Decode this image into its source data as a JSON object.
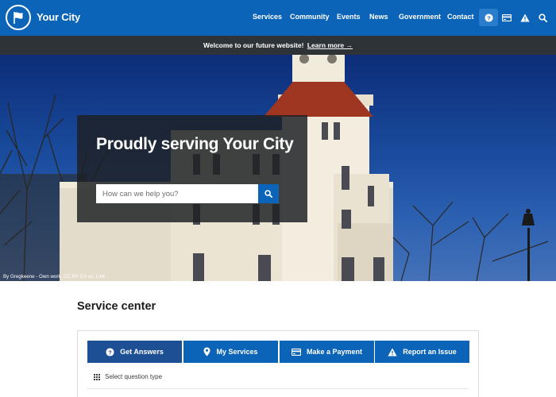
{
  "header": {
    "site_name": "Your City",
    "logo_icon": "flag-icon",
    "nav": [
      "Services",
      "Community",
      "Events",
      "News",
      "Government",
      "Contact"
    ],
    "icons": [
      "help-icon",
      "payment-card-icon",
      "alert-icon",
      "search-icon"
    ]
  },
  "banner": {
    "text": "Welcome to our future website!",
    "link_text": "Learn more →"
  },
  "hero": {
    "title": "Proudly serving Your City",
    "search_placeholder": "How can we help you?",
    "credit": "By Gregkeene - Own work, CC BY 3.0 us, Link"
  },
  "service_center": {
    "title": "Service center",
    "tabs": [
      {
        "label": "Get Answers",
        "icon": "question-icon",
        "active": true
      },
      {
        "label": "My Services",
        "icon": "location-pin-icon",
        "active": false
      },
      {
        "label": "Make a Payment",
        "icon": "payment-card-icon",
        "active": false
      },
      {
        "label": "Report an Issue",
        "icon": "warning-icon",
        "active": false
      }
    ],
    "select_label": "Select question type"
  },
  "colors": {
    "primary": "#0b64b8",
    "primary_dark": "#1c4f93",
    "banner_bg": "#2e3338",
    "card_bg": "#1e2024"
  }
}
